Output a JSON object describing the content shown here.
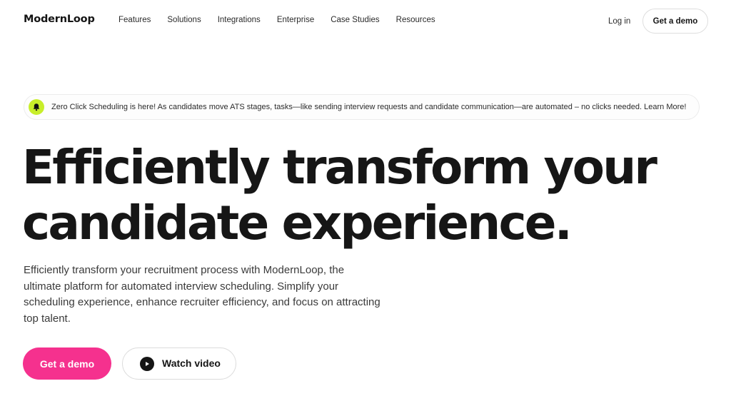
{
  "header": {
    "logo": "ModernLoop",
    "nav": [
      "Features",
      "Solutions",
      "Integrations",
      "Enterprise",
      "Case Studies",
      "Resources"
    ],
    "login_label": "Log in",
    "demo_label": "Get a demo"
  },
  "banner": {
    "icon": "bell-icon",
    "text": "Zero Click Scheduling is here! As candidates move ATS stages, tasks—like sending interview requests and candidate communication—are automated – no clicks needed. Learn More!"
  },
  "hero": {
    "headline_line1": "Efficiently transform your",
    "headline_line2": "candidate experience.",
    "subtext": "Efficiently transform your recruitment process with ModernLoop, the ultimate platform for automated interview scheduling. Simplify your scheduling experience, enhance recruiter efficiency, and focus on attracting top talent.",
    "primary_cta": "Get a demo",
    "secondary_cta": "Watch video",
    "secondary_icon": "play-icon"
  },
  "colors": {
    "accent_pink": "#f5318e",
    "bell_badge": "#c8ee2a",
    "text_dark": "#161616"
  }
}
